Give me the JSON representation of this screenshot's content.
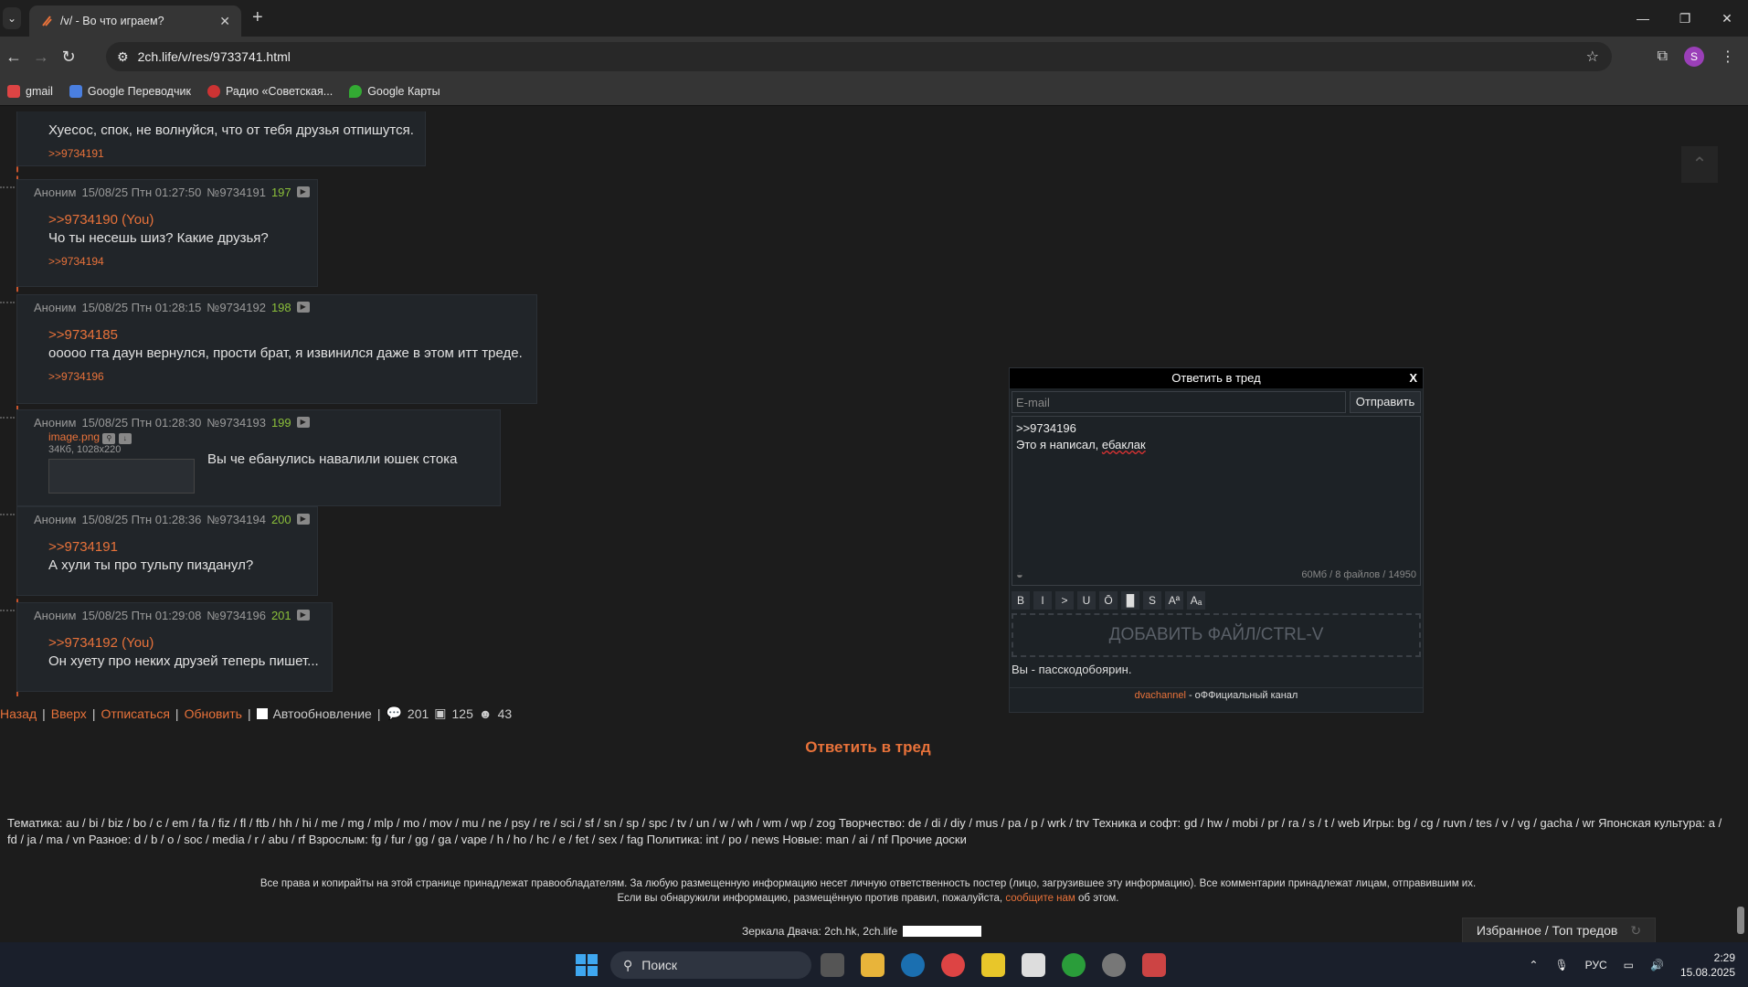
{
  "browser": {
    "tab_title": "/v/ - Во что играем?",
    "url": "2ch.life/v/res/9733741.html",
    "bookmarks": [
      "gmail",
      "Google Переводчик",
      "Радио «Советская...",
      "Google Карты"
    ],
    "avatar_letter": "S"
  },
  "posts": [
    {
      "text": "Хуесос, спок, не волнуйся, что от тебя друзья отпишутся.",
      "answers": ">>9734191"
    },
    {
      "name": "Аноним",
      "date": "15/08/25 Птн 01:27:50",
      "no": "№9734191",
      "num": "197",
      "ref": ">>9734190 (You)",
      "text": "Чо ты несешь шиз? Какие друзья?",
      "answers": ">>9734194"
    },
    {
      "name": "Аноним",
      "date": "15/08/25 Птн 01:28:15",
      "no": "№9734192",
      "num": "198",
      "ref": ">>9734185",
      "text": "ооооо гта даун вернулся, прости брат, я извинился даже в этом итт треде.",
      "answers": ">>9734196"
    },
    {
      "name": "Аноним",
      "date": "15/08/25 Птн 01:28:30",
      "no": "№9734193",
      "num": "199",
      "file": "image.png",
      "file_meta": "34Кб, 1028x220",
      "text": "Вы че ебанулись навалили юшек стока"
    },
    {
      "name": "Аноним",
      "date": "15/08/25 Птн 01:28:36",
      "no": "№9734194",
      "num": "200",
      "ref": ">>9734191",
      "text": "А хули ты про тульпу пизданул?"
    },
    {
      "name": "Аноним",
      "date": "15/08/25 Птн 01:29:08",
      "no": "№9734196",
      "num": "201",
      "ref": ">>9734192 (You)",
      "text": "Он хуету про неких друзей теперь пишет..."
    }
  ],
  "nav": {
    "back": "Назад",
    "up": "Вверх",
    "unsub": "Отписаться",
    "refresh": "Обновить",
    "auto": "Автообновление",
    "posts": "201",
    "files": "125",
    "users": "43"
  },
  "reply_thread": "Ответить в тред",
  "form": {
    "title": "Ответить в тред",
    "close": "X",
    "email_placeholder": "E-mail",
    "send": "Отправить",
    "line1": ">>9734196",
    "line2a": "Это я написал, ",
    "line2b": "ебаклак",
    "counter": "60Мб / 8 файлов / 14950",
    "dropzone": "ДОБАВИТЬ ФАЙЛ/CTRL-V",
    "passcode": "Вы - пасскодобоярин.",
    "channel_link": "dvachannel",
    "channel_text": " - оФФициальный канал",
    "tools": [
      "B",
      "I",
      ">",
      "U",
      "Ō",
      "█",
      "S",
      "Aª",
      "Aₐ"
    ]
  },
  "boards": {
    "line": "Тематика: au / bi / biz / bo / c / em / fa / fiz / fl / ftb / hh / hi / me / mg / mlp / mo / mov / mu / ne / psy / re / sci / sf / sn / sp / spc / tv / un / w / wh / wm / wp / zog Творчество: de / di / diy / mus / pa / p / wrk / trv Техника и софт: gd / hw / mobi / pr / ra / s / t / web Игры: bg / cg / ruvn / tes / v / vg / gacha / wr Японская культура: a / fd / ja / ma / vn Разное: d / b / o / soc / media / r / abu / rf Взрослым: fg / fur / gg / ga / vape / h / ho / hc / e / fet / sex / fag Политика: int / po / news Новые: man / ai / nf  Прочие доски"
  },
  "footer": {
    "line1": "Все права и копирайты на этой странице принадлежат правообладателям. За любую размещенную информацию несет личную ответственность постер (лицо, загрузившее эту информацию). Все комментарии принадлежат лицам, отправившим их.",
    "line2a": "Если вы обнаружили информацию, размещённую против правил, пожалуйста, ",
    "line2link": "сообщите нам",
    "line2b": " об этом.",
    "mirrors": "Зеркала Двача: 2ch.hk, 2ch.life",
    "fav": "Избранное / Топ тредов"
  },
  "taskbar": {
    "search": "Поиск",
    "lang": "РУС",
    "time": "2:29",
    "date": "15.08.2025"
  }
}
